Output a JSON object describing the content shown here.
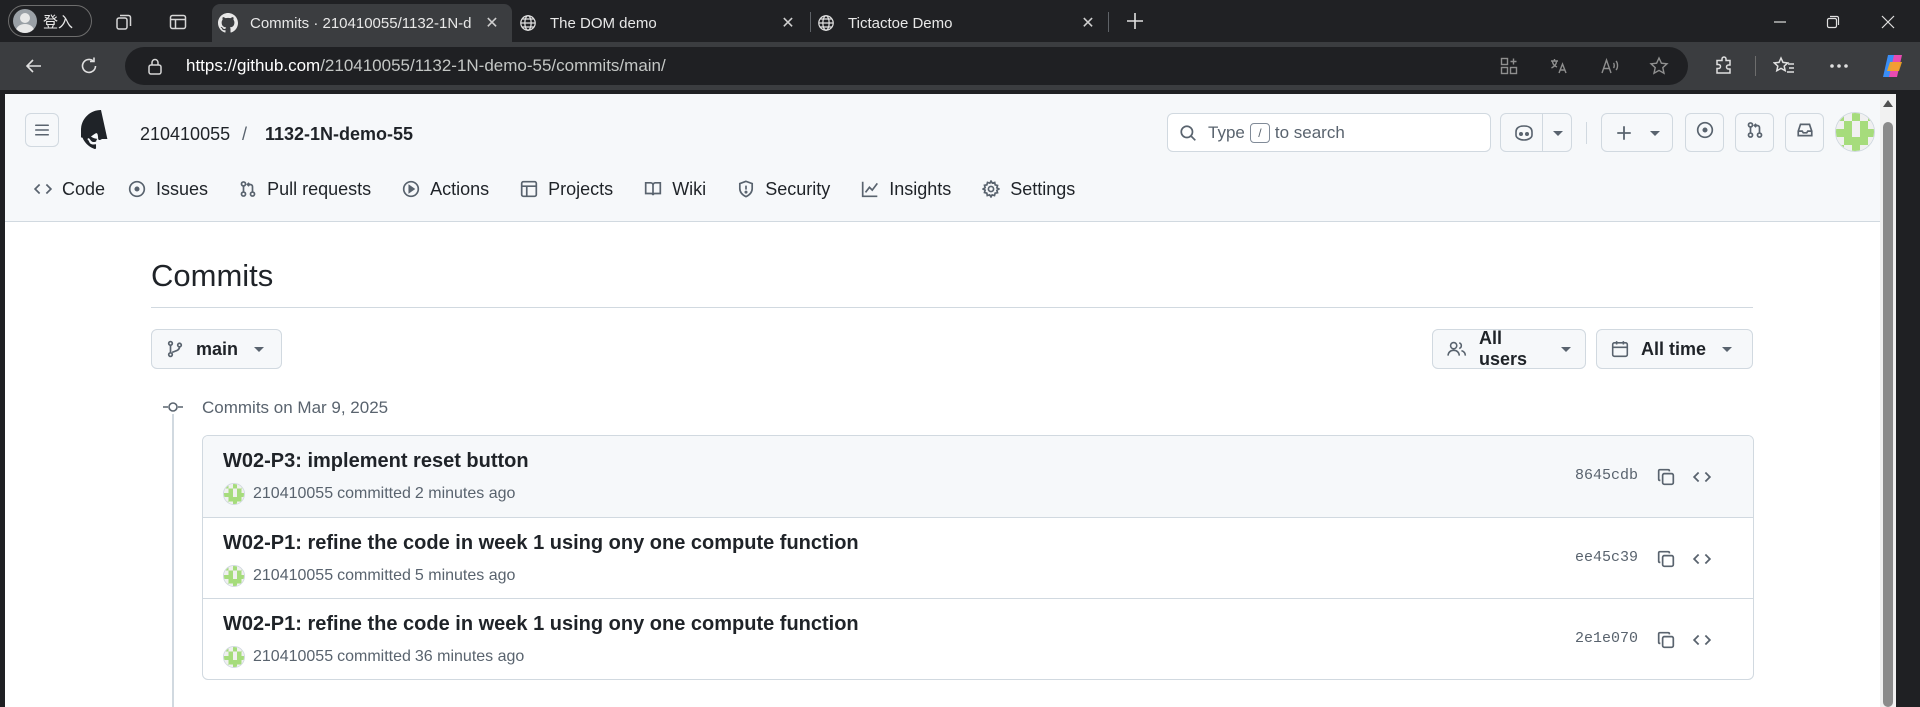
{
  "browser": {
    "profile_label": "登入",
    "tabs": [
      {
        "title": "Commits · 210410055/1132-1N-demo-55",
        "favicon": "github-icon",
        "active": true
      },
      {
        "title": "The DOM demo",
        "favicon": "globe-icon",
        "active": false
      },
      {
        "title": "Tictactoe Demo",
        "favicon": "globe-icon",
        "active": false
      }
    ],
    "tab_close_glyph": "✕",
    "url_host": "https://github.com",
    "url_path": "/210410055/1132-1N-demo-55/commits/main/"
  },
  "header": {
    "owner": "210410055",
    "separator": "/",
    "repo": "1132-1N-demo-55",
    "search_prefix": "Type",
    "search_key": "/",
    "search_suffix": "to search"
  },
  "nav": [
    {
      "label": "Code",
      "icon": "code-icon"
    },
    {
      "label": "Issues",
      "icon": "issue-icon"
    },
    {
      "label": "Pull requests",
      "icon": "pull-request-icon"
    },
    {
      "label": "Actions",
      "icon": "play-icon"
    },
    {
      "label": "Projects",
      "icon": "table-icon"
    },
    {
      "label": "Wiki",
      "icon": "book-icon"
    },
    {
      "label": "Security",
      "icon": "shield-icon"
    },
    {
      "label": "Insights",
      "icon": "graph-icon"
    },
    {
      "label": "Settings",
      "icon": "gear-icon"
    }
  ],
  "main": {
    "title": "Commits",
    "branch": "main",
    "users_filter": "All users",
    "time_filter": "All time",
    "group_label": "Commits on Mar 9, 2025",
    "commits": [
      {
        "message": "W02-P3: implement reset button",
        "author": "210410055",
        "verb": "committed",
        "time": "2 minutes ago",
        "sha": "8645cdb"
      },
      {
        "message": "W02-P1: refine the code in week 1 using ony one compute function",
        "author": "210410055",
        "verb": "committed",
        "time": "5 minutes ago",
        "sha": "ee45c39"
      },
      {
        "message": "W02-P1: refine the code in week 1 using ony one compute function",
        "author": "210410055",
        "verb": "committed",
        "time": "36 minutes ago",
        "sha": "2e1e070"
      }
    ]
  },
  "colors": {
    "text_primary": "#1f2328",
    "text_muted": "#59636e",
    "border": "#d1d9e0",
    "header_bg": "#f6f8fa",
    "avatar_green": "#a6dc7c"
  }
}
